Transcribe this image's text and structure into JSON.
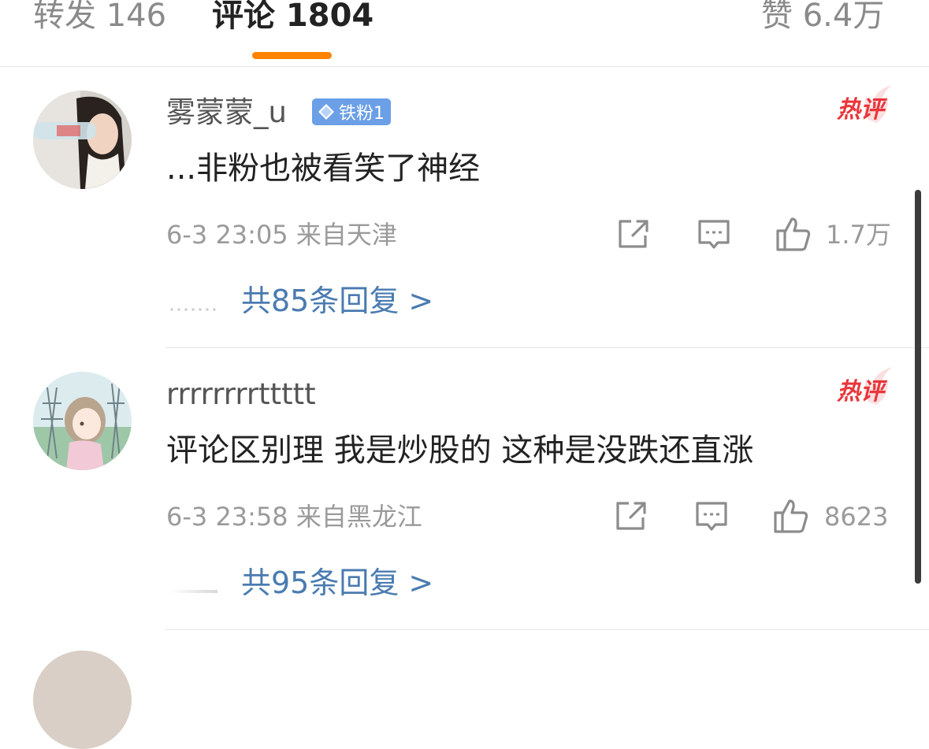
{
  "tabs": [
    {
      "label": "转发 146",
      "active": false
    },
    {
      "label": "评论 1804",
      "active": true
    },
    {
      "label": "赞 6.4万",
      "active": false
    }
  ],
  "colors": {
    "accent_orange": "#ff8200",
    "link_blue": "#4a7bb0",
    "hot_red": "#e8363b",
    "badge_blue": "#6b9fe6",
    "meta_gray": "#9a9a9a"
  },
  "comments": [
    {
      "username": "雾蒙蒙_u",
      "badge": "铁粉1",
      "badge_icon": "diamond-icon",
      "hot_label": "热评",
      "text": "...非粉也被看笑了神经",
      "meta": "6-3 23:05 来自天津",
      "likes": "1.7万",
      "replies": "共85条回复 >"
    },
    {
      "username": "rrrrrrrrttttt",
      "hot_label": "热评",
      "text": "评论区别理 我是炒股的 这种是没跌还直涨",
      "meta": "6-3 23:58 来自黑龙江",
      "likes": "8623",
      "replies": "共95条回复 >"
    }
  ],
  "icons": {
    "share": "share-icon",
    "comment": "comment-icon",
    "like": "thumbs-up-icon"
  }
}
